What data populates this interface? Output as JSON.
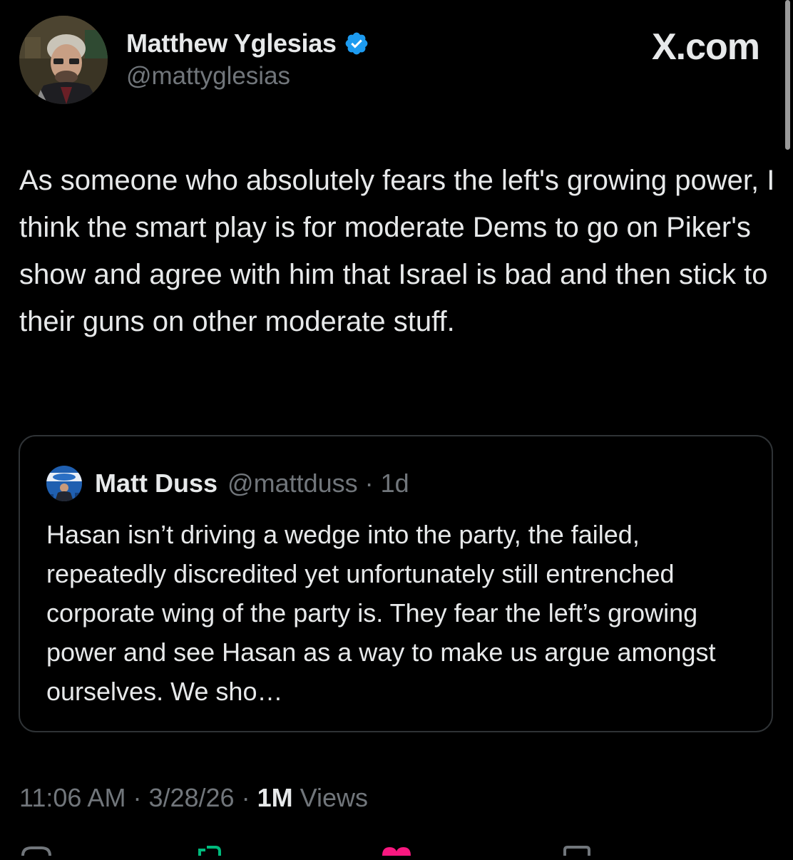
{
  "site": {
    "logo_text": "X.com"
  },
  "author": {
    "display_name": "Matthew Yglesias",
    "handle": "@mattyglesias",
    "verified": true,
    "avatar_icon": "profile-photo"
  },
  "tweet": {
    "text": "As someone who absolutely fears the left's growing power, I think the smart play is for moderate Dems to go on Piker's show and agree with him that Israel is bad and then stick to their guns on other moderate stuff."
  },
  "quoted_tweet": {
    "display_name": "Matt Duss",
    "handle_and_time": "@mattduss · 1d",
    "text": "Hasan isn’t driving a wedge into the party, the failed, repeatedly discredited yet unfortunately still entrenched corporate wing of the party is. They fear the left’s growing power and see Hasan as a way to make us argue amongst ourselves. We sho…",
    "avatar_icon": "profile-photo"
  },
  "meta": {
    "time": "11:06 AM",
    "separator": " · ",
    "date": "3/28/26",
    "views_count": "1M",
    "views_label": "Views"
  },
  "colors": {
    "background": "#000000",
    "primary_text": "#e7e9ea",
    "secondary_text": "#71767b",
    "border": "#2f3336",
    "verified": "#1d9bf0",
    "like": "#f91880",
    "repost": "#00ba7c"
  },
  "actions": [
    {
      "name": "reply-icon"
    },
    {
      "name": "repost-icon"
    },
    {
      "name": "like-icon"
    },
    {
      "name": "bookmark-icon"
    }
  ]
}
